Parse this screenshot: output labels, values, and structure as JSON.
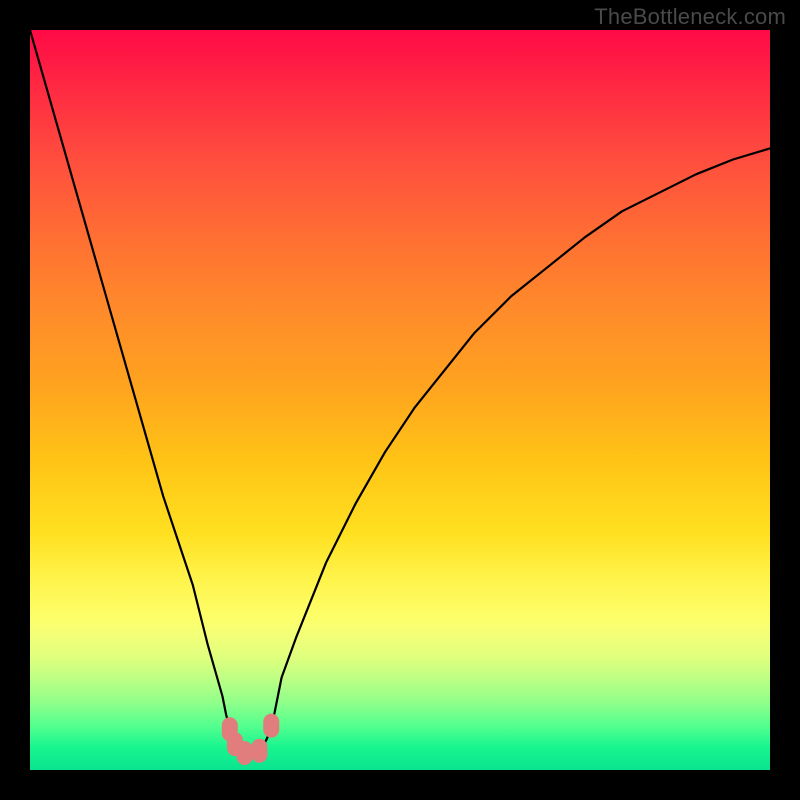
{
  "watermark": "TheBottleneck.com",
  "chart_data": {
    "type": "line",
    "title": "",
    "xlabel": "",
    "ylabel": "",
    "xlim": [
      0,
      100
    ],
    "ylim": [
      0,
      100
    ],
    "series": [
      {
        "name": "bottleneck-curve",
        "x": [
          0,
          2,
          4,
          6,
          8,
          10,
          12,
          14,
          16,
          18,
          20,
          22,
          24,
          26,
          26.5,
          27,
          27.5,
          28,
          28.5,
          29,
          29.5,
          30,
          30.5,
          31,
          31.5,
          32,
          32.5,
          33,
          33.5,
          34,
          36,
          38,
          40,
          44,
          48,
          52,
          56,
          60,
          65,
          70,
          75,
          80,
          85,
          90,
          95,
          100
        ],
        "values": [
          100,
          93,
          86,
          79,
          72,
          65,
          58,
          51,
          44,
          37,
          31,
          25,
          17,
          10,
          7.5,
          5.5,
          4.2,
          3.2,
          2.6,
          2.3,
          2.2,
          2.2,
          2.3,
          2.6,
          3.2,
          4.2,
          5.5,
          7.5,
          10,
          12.5,
          18,
          23,
          28,
          36,
          43,
          49,
          54,
          59,
          64,
          68,
          72,
          75.5,
          78,
          80.5,
          82.5,
          84
        ]
      }
    ],
    "markers": [
      {
        "name": "left-marker-upper",
        "x": 27.0,
        "y": 5.5
      },
      {
        "name": "left-marker-lower",
        "x": 27.7,
        "y": 3.5
      },
      {
        "name": "valley-left",
        "x": 29.0,
        "y": 2.3
      },
      {
        "name": "valley-right",
        "x": 31.0,
        "y": 2.6
      },
      {
        "name": "right-marker",
        "x": 32.6,
        "y": 6.0
      }
    ],
    "gradient_stops": [
      {
        "pos": 0,
        "color": "#ff0a46"
      },
      {
        "pos": 50,
        "color": "#ffb018"
      },
      {
        "pos": 78,
        "color": "#fff34a"
      },
      {
        "pos": 100,
        "color": "#0ae48f"
      }
    ]
  }
}
